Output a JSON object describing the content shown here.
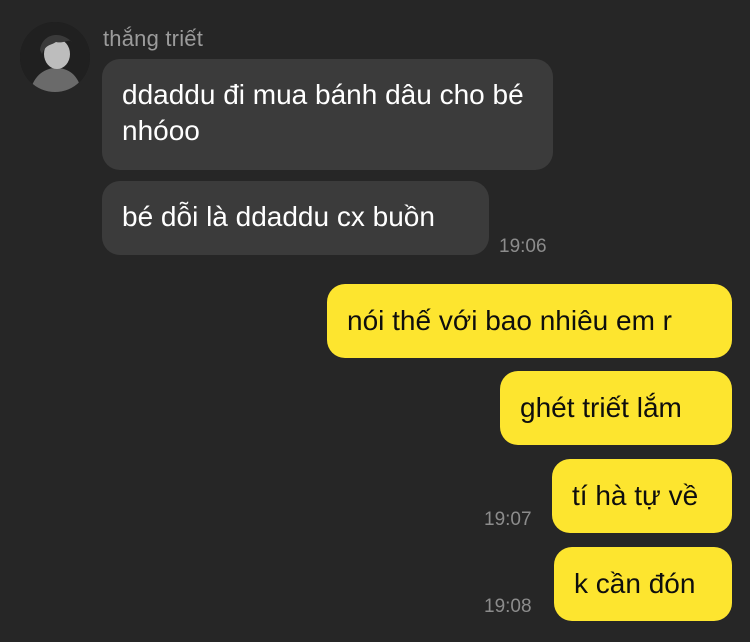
{
  "chat": {
    "sender": {
      "name": "thắng triết",
      "avatar_icon": "user-avatar-icon"
    },
    "incoming": [
      {
        "text": "ddaddu đi mua bánh dâu cho bé nhóoo",
        "time": ""
      },
      {
        "text": "bé dỗi là ddaddu cx buồn",
        "time": "19:06"
      }
    ],
    "outgoing": [
      {
        "text": "nói thế với bao nhiêu em r",
        "time": ""
      },
      {
        "text": "ghét triết lắm",
        "time": ""
      },
      {
        "text": "tí hà tự về",
        "time": "19:07"
      },
      {
        "text": "k cần đón",
        "time": "19:08"
      }
    ]
  },
  "colors": {
    "background": "#262626",
    "incoming_bubble": "#3b3b3b",
    "outgoing_bubble": "#fde52f",
    "sender_name": "#9b9b9b",
    "timestamp": "#8c8c8c"
  }
}
